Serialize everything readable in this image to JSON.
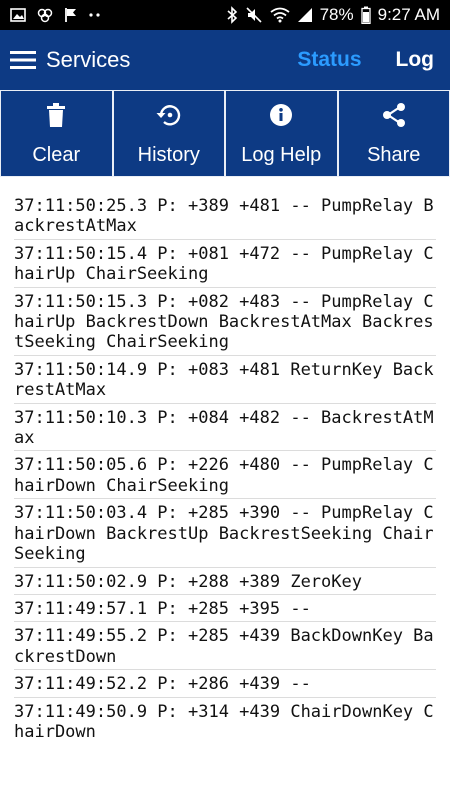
{
  "status_bar": {
    "battery": "78%",
    "time": "9:27 AM",
    "left_icons": [
      "image-icon",
      "clover-icon",
      "flag-icon",
      "more-dots-icon"
    ],
    "right_icons": [
      "bluetooth-icon",
      "mute-icon",
      "wifi-icon",
      "signal-icon",
      "battery-icon"
    ]
  },
  "app_bar": {
    "title": "Services",
    "tab_status": "Status",
    "tab_log": "Log",
    "colors": {
      "bar": "#0d3a84",
      "active_tab": "#2b9bff"
    }
  },
  "actions": [
    {
      "label": "Clear",
      "icon": "trash-icon"
    },
    {
      "label": "History",
      "icon": "history-icon"
    },
    {
      "label": "Log Help",
      "icon": "info-icon"
    },
    {
      "label": "Share",
      "icon": "share-icon"
    }
  ],
  "log": [
    "37:11:50:25.3 P: +389 +481 -- PumpRelay BackrestAtMax",
    "37:11:50:15.4 P: +081 +472 -- PumpRelay ChairUp ChairSeeking",
    "37:11:50:15.3 P: +082 +483 -- PumpRelay ChairUp BackrestDown BackrestAtMax BackrestSeeking ChairSeeking",
    "37:11:50:14.9 P: +083 +481 ReturnKey BackrestAtMax",
    "37:11:50:10.3 P: +084 +482 -- BackrestAtMax",
    "37:11:50:05.6 P: +226 +480 -- PumpRelay ChairDown ChairSeeking",
    "37:11:50:03.4 P: +285 +390 -- PumpRelay ChairDown BackrestUp BackrestSeeking ChairSeeking",
    "37:11:50:02.9 P: +288 +389 ZeroKey",
    "37:11:49:57.1 P: +285 +395 --",
    "37:11:49:55.2 P: +285 +439 BackDownKey BackrestDown",
    "37:11:49:52.2 P: +286 +439 --",
    "37:11:49:50.9 P: +314 +439 ChairDownKey ChairDown"
  ]
}
